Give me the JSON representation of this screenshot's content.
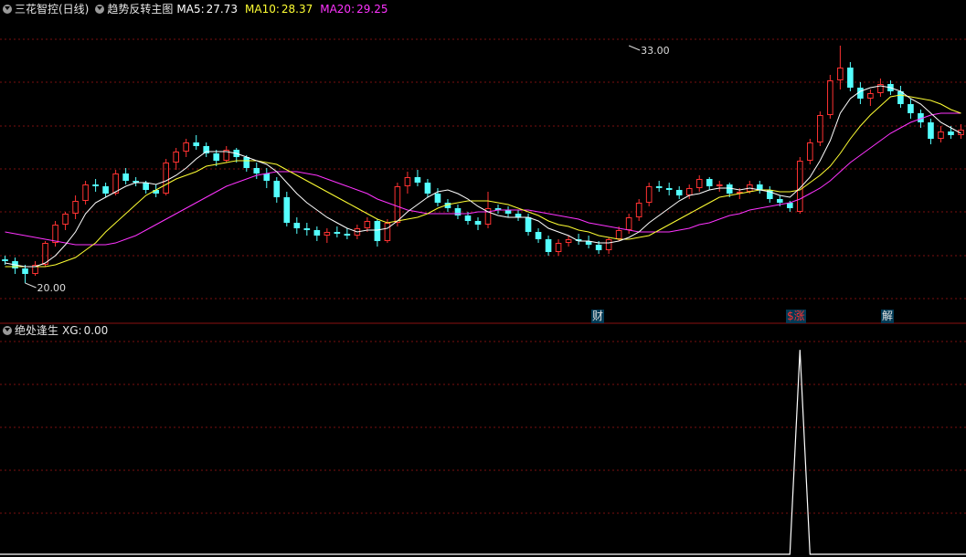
{
  "header": {
    "stock_name": "三花智控(日线)",
    "indicator_name": "趋势反转主图",
    "ma5_label": "MA5:",
    "ma5_value": "27.73",
    "ma10_label": "MA10:",
    "ma10_value": "28.37",
    "ma20_label": "MA20:",
    "ma20_value": "29.25"
  },
  "sub_header": {
    "indicator_name": "绝处逢生",
    "xg_label": "XG:",
    "xg_value": "0.00"
  },
  "markers": [
    {
      "text": "财",
      "color": "#e0e0e0",
      "bg": "#003a55"
    },
    {
      "text": "$涨",
      "color": "#ff3030",
      "bg": "#003a55"
    },
    {
      "text": "解",
      "color": "#e0e0e0",
      "bg": "#003a55"
    }
  ],
  "colors": {
    "up": "#ff3232",
    "down": "#54ffff",
    "ma5": "#ffffff",
    "ma10": "#ffff33",
    "ma20": "#ff33ff",
    "grid": "#7a1010",
    "signal": "#ffffff"
  },
  "chart_data": {
    "type": "candlestick",
    "ylim": [
      18.5,
      34.5
    ],
    "annotations": [
      {
        "text": "33.00",
        "value": 33.0,
        "bar": 62
      },
      {
        "text": "20.00",
        "value": 20.0,
        "bar": 2
      }
    ],
    "candles": [
      [
        21.3,
        21.5,
        21.0,
        21.2
      ],
      [
        21.2,
        21.4,
        20.5,
        20.8
      ],
      [
        20.8,
        21.0,
        20.0,
        20.5
      ],
      [
        20.5,
        21.2,
        20.4,
        21.0
      ],
      [
        21.0,
        22.3,
        20.9,
        22.2
      ],
      [
        22.2,
        23.4,
        22.0,
        23.2
      ],
      [
        23.2,
        23.9,
        22.9,
        23.8
      ],
      [
        23.8,
        24.8,
        23.5,
        24.5
      ],
      [
        24.5,
        25.6,
        24.3,
        25.4
      ],
      [
        25.4,
        25.7,
        25.0,
        25.3
      ],
      [
        25.3,
        25.5,
        24.7,
        24.9
      ],
      [
        24.9,
        26.2,
        24.8,
        26.0
      ],
      [
        26.0,
        26.3,
        25.4,
        25.6
      ],
      [
        25.6,
        25.8,
        25.3,
        25.5
      ],
      [
        25.5,
        25.6,
        24.9,
        25.1
      ],
      [
        25.1,
        25.4,
        24.7,
        24.9
      ],
      [
        24.9,
        26.8,
        24.8,
        26.6
      ],
      [
        26.6,
        27.4,
        26.2,
        27.2
      ],
      [
        27.2,
        27.9,
        26.9,
        27.7
      ],
      [
        27.7,
        28.1,
        27.3,
        27.5
      ],
      [
        27.5,
        27.7,
        26.9,
        27.1
      ],
      [
        27.1,
        27.3,
        26.4,
        26.7
      ],
      [
        26.7,
        27.5,
        26.6,
        27.3
      ],
      [
        27.3,
        27.4,
        26.6,
        26.9
      ],
      [
        26.9,
        27.0,
        26.1,
        26.3
      ],
      [
        26.3,
        26.6,
        25.7,
        26.0
      ],
      [
        26.0,
        26.3,
        25.2,
        25.6
      ],
      [
        25.6,
        25.8,
        24.4,
        24.7
      ],
      [
        24.7,
        25.0,
        23.1,
        23.3
      ],
      [
        23.3,
        23.6,
        22.7,
        23.0
      ],
      [
        23.0,
        23.3,
        22.6,
        22.9
      ],
      [
        22.9,
        23.1,
        22.3,
        22.6
      ],
      [
        22.6,
        23.0,
        22.2,
        22.8
      ],
      [
        22.8,
        23.1,
        22.5,
        22.7
      ],
      [
        22.7,
        23.0,
        22.4,
        22.6
      ],
      [
        22.6,
        23.2,
        22.4,
        23.0
      ],
      [
        23.0,
        23.6,
        22.8,
        23.4
      ],
      [
        23.4,
        23.5,
        22.0,
        22.3
      ],
      [
        22.3,
        23.5,
        22.2,
        23.3
      ],
      [
        23.3,
        25.5,
        23.1,
        25.3
      ],
      [
        25.3,
        26.1,
        24.9,
        25.8
      ],
      [
        25.8,
        26.2,
        25.3,
        25.5
      ],
      [
        25.5,
        25.7,
        24.7,
        24.9
      ],
      [
        24.9,
        25.2,
        24.2,
        24.4
      ],
      [
        24.4,
        24.6,
        23.9,
        24.1
      ],
      [
        24.1,
        24.3,
        23.5,
        23.7
      ],
      [
        23.7,
        23.9,
        23.2,
        23.4
      ],
      [
        23.4,
        23.6,
        22.9,
        23.2
      ],
      [
        23.2,
        25.0,
        23.0,
        24.1
      ],
      [
        24.1,
        24.3,
        23.8,
        24.0
      ],
      [
        24.0,
        24.2,
        23.6,
        23.8
      ],
      [
        23.8,
        24.0,
        23.4,
        23.6
      ],
      [
        23.6,
        23.8,
        22.6,
        22.8
      ],
      [
        22.8,
        23.0,
        22.2,
        22.4
      ],
      [
        22.4,
        22.6,
        21.5,
        21.7
      ],
      [
        21.7,
        22.4,
        21.5,
        22.2
      ],
      [
        22.2,
        22.6,
        22.0,
        22.4
      ],
      [
        22.4,
        22.7,
        22.1,
        22.3
      ],
      [
        22.3,
        22.6,
        21.9,
        22.1
      ],
      [
        22.1,
        22.3,
        21.6,
        21.8
      ],
      [
        21.8,
        22.5,
        21.6,
        22.4
      ],
      [
        22.4,
        23.1,
        22.3,
        22.9
      ],
      [
        22.9,
        23.8,
        22.7,
        23.6
      ],
      [
        23.6,
        24.6,
        23.4,
        24.4
      ],
      [
        24.4,
        25.5,
        24.2,
        25.3
      ],
      [
        25.3,
        25.6,
        25.0,
        25.2
      ],
      [
        25.2,
        25.5,
        24.8,
        25.1
      ],
      [
        25.1,
        25.3,
        24.6,
        24.8
      ],
      [
        24.8,
        25.4,
        24.6,
        25.2
      ],
      [
        25.2,
        25.9,
        25.0,
        25.7
      ],
      [
        25.7,
        25.8,
        25.1,
        25.3
      ],
      [
        25.3,
        25.6,
        25.0,
        25.4
      ],
      [
        25.4,
        25.5,
        24.7,
        24.9
      ],
      [
        24.9,
        25.2,
        24.6,
        25.0
      ],
      [
        25.0,
        25.6,
        24.9,
        25.4
      ],
      [
        25.4,
        25.6,
        24.9,
        25.1
      ],
      [
        25.1,
        25.3,
        24.4,
        24.6
      ],
      [
        24.6,
        24.8,
        24.2,
        24.4
      ],
      [
        24.4,
        24.5,
        23.9,
        24.1
      ],
      [
        23.9,
        26.9,
        23.8,
        26.7
      ],
      [
        26.7,
        27.9,
        26.5,
        27.7
      ],
      [
        27.7,
        29.4,
        27.5,
        29.2
      ],
      [
        29.2,
        31.4,
        29.0,
        31.1
      ],
      [
        31.1,
        33.0,
        30.6,
        31.8
      ],
      [
        31.8,
        32.1,
        30.5,
        30.7
      ],
      [
        30.7,
        31.0,
        29.8,
        30.1
      ],
      [
        30.1,
        30.6,
        29.7,
        30.4
      ],
      [
        30.4,
        31.2,
        30.2,
        30.9
      ],
      [
        30.9,
        31.1,
        30.3,
        30.5
      ],
      [
        30.5,
        30.8,
        29.6,
        29.8
      ],
      [
        29.8,
        30.1,
        29.0,
        29.3
      ],
      [
        29.3,
        29.5,
        28.5,
        28.8
      ],
      [
        28.8,
        29.0,
        27.6,
        27.9
      ],
      [
        27.9,
        28.6,
        27.7,
        28.3
      ],
      [
        28.3,
        28.6,
        27.9,
        28.1
      ],
      [
        28.1,
        28.7,
        27.9,
        28.4
      ]
    ],
    "ma5": [
      21.1,
      21.0,
      20.9,
      20.9,
      21.1,
      21.5,
      22.1,
      22.8,
      23.8,
      24.4,
      24.7,
      25.0,
      25.3,
      25.5,
      25.5,
      25.4,
      25.6,
      25.9,
      26.3,
      26.8,
      27.2,
      27.2,
      27.2,
      27.1,
      26.9,
      26.7,
      26.5,
      26.1,
      25.5,
      24.9,
      24.4,
      24.0,
      23.6,
      23.3,
      23.0,
      22.8,
      22.9,
      22.9,
      23.0,
      23.4,
      23.9,
      24.3,
      24.7,
      25.0,
      25.1,
      24.9,
      24.6,
      24.2,
      23.9,
      23.7,
      23.6,
      23.6,
      23.6,
      23.4,
      23.0,
      22.8,
      22.6,
      22.3,
      22.3,
      22.2,
      22.2,
      22.3,
      22.5,
      22.8,
      23.3,
      23.7,
      24.1,
      24.5,
      24.8,
      24.9,
      25.1,
      25.2,
      25.2,
      25.1,
      25.2,
      25.1,
      25.0,
      24.8,
      24.7,
      25.2,
      25.8,
      26.7,
      27.8,
      29.3,
      30.1,
      30.5,
      30.7,
      30.8,
      30.7,
      30.5,
      30.1,
      29.8,
      29.3,
      28.8,
      28.5,
      28.2
    ],
    "ma10": [
      20.9,
      20.9,
      20.9,
      20.9,
      20.9,
      21.0,
      21.2,
      21.4,
      21.8,
      22.2,
      22.8,
      23.3,
      23.8,
      24.3,
      24.8,
      25.1,
      25.4,
      25.7,
      25.9,
      26.1,
      26.4,
      26.5,
      26.6,
      26.7,
      26.7,
      26.7,
      26.6,
      26.5,
      26.2,
      25.9,
      25.6,
      25.3,
      25.0,
      24.7,
      24.4,
      24.1,
      23.8,
      23.5,
      23.3,
      23.4,
      23.5,
      23.6,
      23.8,
      24.1,
      24.3,
      24.4,
      24.5,
      24.5,
      24.5,
      24.4,
      24.3,
      24.1,
      23.9,
      23.7,
      23.4,
      23.2,
      23.1,
      22.9,
      22.8,
      22.6,
      22.5,
      22.4,
      22.4,
      22.5,
      22.6,
      22.9,
      23.2,
      23.5,
      23.8,
      24.1,
      24.4,
      24.7,
      24.8,
      24.9,
      25.0,
      25.1,
      25.1,
      25.0,
      25.0,
      25.1,
      25.5,
      25.9,
      26.4,
      27.1,
      27.9,
      28.6,
      29.2,
      29.7,
      30.2,
      30.3,
      30.2,
      30.1,
      30.0,
      29.8,
      29.5,
      29.3
    ],
    "ma20": [
      22.8,
      22.7,
      22.6,
      22.5,
      22.4,
      22.3,
      22.2,
      22.1,
      22.1,
      22.1,
      22.1,
      22.2,
      22.4,
      22.6,
      22.9,
      23.2,
      23.5,
      23.8,
      24.1,
      24.4,
      24.7,
      25.0,
      25.3,
      25.5,
      25.7,
      25.9,
      26.0,
      26.1,
      26.1,
      26.1,
      26.0,
      25.9,
      25.7,
      25.5,
      25.3,
      25.1,
      24.9,
      24.6,
      24.4,
      24.2,
      24.0,
      23.9,
      23.8,
      23.8,
      23.8,
      23.8,
      23.8,
      23.9,
      23.9,
      24.0,
      24.0,
      24.0,
      24.0,
      23.9,
      23.8,
      23.7,
      23.6,
      23.5,
      23.3,
      23.2,
      23.1,
      23.0,
      22.9,
      22.8,
      22.8,
      22.8,
      22.8,
      22.9,
      23.0,
      23.2,
      23.3,
      23.5,
      23.7,
      23.8,
      24.0,
      24.1,
      24.2,
      24.3,
      24.4,
      24.6,
      24.9,
      25.2,
      25.6,
      26.1,
      26.6,
      27.0,
      27.4,
      27.8,
      28.2,
      28.5,
      28.8,
      29.0,
      29.2,
      29.3,
      29.3,
      29.3
    ],
    "sub": {
      "ylim": [
        0,
        1.05
      ],
      "signal_bar": 79,
      "signal_value": 1
    }
  }
}
